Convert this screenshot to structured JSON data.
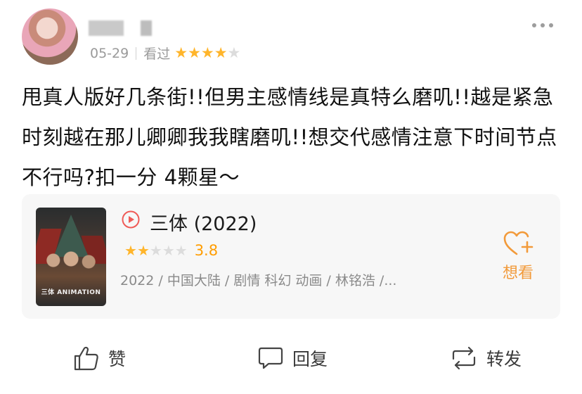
{
  "post": {
    "date": "05-29",
    "status": "看过",
    "user_rating": 4,
    "text": "甩真人版好几条街!!但男主感情线是真特么磨叽!!越是紧急时刻越在那儿卿卿我我瞎磨叽!!想交代感情注意下时间节点不行吗?扣一分 4颗星～"
  },
  "card": {
    "title": "三体 (2022)",
    "rating_stars": 2,
    "score": "3.8",
    "info": "2022 / 中国大陆 / 剧情 科幻 动画 / 林铭浩 /...",
    "want_label": "想看",
    "poster_text": "三体 ANIMATION"
  },
  "actions": {
    "like": "赞",
    "comment": "回复",
    "repost": "转发"
  },
  "colors": {
    "star_on": "#ffb52b",
    "star_off": "#dcdcdc",
    "accent": "#f29a3a",
    "play": "#ef5b57"
  },
  "icons": [
    "more-icon",
    "play-icon",
    "heart-plus-icon",
    "thumb-up-icon",
    "comment-icon",
    "repost-icon"
  ]
}
